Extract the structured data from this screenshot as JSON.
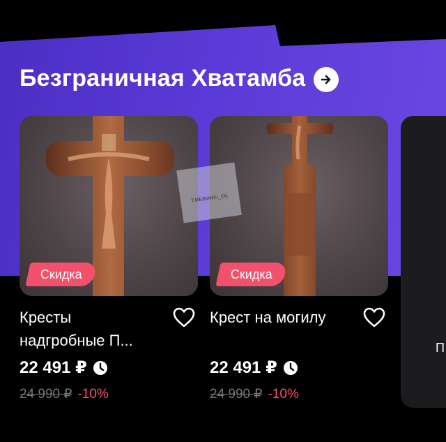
{
  "section": {
    "title": "Безграничная Хватамба"
  },
  "products": [
    {
      "name": "Кресты надгробные П...",
      "badge": "Скидка",
      "price": "22 491 ₽",
      "old_price": "24 990 ₽",
      "discount": "-10%"
    },
    {
      "name": "Крест на могилу",
      "badge": "Скидка",
      "price": "22 491 ₽",
      "old_price": "24 990 ₽",
      "discount": "-10%"
    }
  ],
  "partial_card": {
    "text": "П"
  },
  "watermark": {
    "text": "T.ME/BANKI_OIL"
  },
  "colors": {
    "banner": "#5a3ad6",
    "badge": "#f2506b",
    "discount": "#ff4d6a"
  }
}
